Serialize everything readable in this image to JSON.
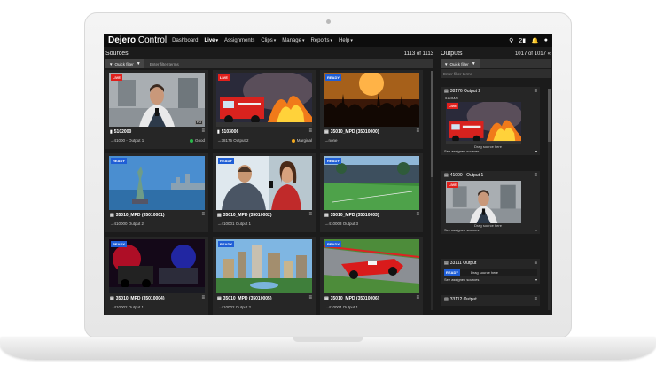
{
  "app": {
    "brand_bold": "Dejero",
    "brand_light": " Control",
    "nav": [
      {
        "label": "Dashboard",
        "dropdown": false,
        "active": false
      },
      {
        "label": "Live",
        "dropdown": true,
        "active": true
      },
      {
        "label": "Assignments",
        "dropdown": false,
        "active": false
      },
      {
        "label": "Clips",
        "dropdown": true,
        "active": false
      },
      {
        "label": "Manage",
        "dropdown": true,
        "active": false
      },
      {
        "label": "Reports",
        "dropdown": true,
        "active": false
      },
      {
        "label": "Help",
        "dropdown": true,
        "active": false
      }
    ],
    "notification_count": "2"
  },
  "sources": {
    "title": "Sources",
    "count": "1113 of 1113",
    "filter_button": "Quick filter",
    "filter_placeholder": "Enter filter terms",
    "cards": [
      {
        "name": "5102000",
        "dest": "→41000 - Output 1",
        "status": "Good",
        "status_color": "#2ab94a",
        "badge": "LIVE",
        "hd": "HD",
        "scene": "reporter"
      },
      {
        "name": "5103006",
        "dest": "→38176 Output 2",
        "status": "Marginal",
        "status_color": "#f2a81d",
        "badge": "LIVE",
        "hd": "",
        "scene": "firetruck"
      },
      {
        "name": "35010_MPD (35010000)",
        "dest": "→none",
        "status": "",
        "status_color": "",
        "badge": "READY",
        "hd": "",
        "scene": "concert"
      },
      {
        "name": "35010_MPD (35010001)",
        "dest": "→410000 Output 2",
        "status": "",
        "status_color": "",
        "badge": "READY",
        "hd": "",
        "scene": "liberty"
      },
      {
        "name": "35010_MPD (35010002)",
        "dest": "→410001 Output 1",
        "status": "",
        "status_color": "",
        "badge": "READY",
        "hd": "",
        "scene": "interview"
      },
      {
        "name": "35010_MPD (35010003)",
        "dest": "→410003 Output 3",
        "status": "",
        "status_color": "",
        "badge": "READY",
        "hd": "",
        "scene": "stadium"
      },
      {
        "name": "35010_MPD (35010004)",
        "dest": "→410002 Output 1",
        "status": "",
        "status_color": "",
        "badge": "READY",
        "hd": "",
        "scene": "police"
      },
      {
        "name": "35010_MPD (35010005)",
        "dest": "→410002 Output 2",
        "status": "",
        "status_color": "",
        "badge": "READY",
        "hd": "",
        "scene": "city"
      },
      {
        "name": "35010_MPD (35010006)",
        "dest": "→410004 Output 1",
        "status": "",
        "status_color": "",
        "badge": "READY",
        "hd": "",
        "scene": "racecar"
      }
    ]
  },
  "outputs": {
    "title": "Outputs",
    "count": "1017 of 1017",
    "filter_button": "Quick filter",
    "filter_placeholder": "Enter filter terms",
    "cards": [
      {
        "name": "38176 Output 2",
        "source_id": "5103006",
        "badge": "LIVE",
        "drag": "Drag source here",
        "assigned": "See assigned sources",
        "scene": "firetruck",
        "ready_text": ""
      },
      {
        "name": "41000 - Output 1",
        "source_id": "",
        "badge": "LIVE",
        "drag": "Drag source here",
        "assigned": "See assigned sources",
        "scene": "reporter",
        "ready_text": ""
      },
      {
        "name": "33111 Output",
        "source_id": "",
        "badge": "READY",
        "drag": "",
        "assigned": "See assigned sources",
        "scene": "",
        "ready_text": "Drag source here"
      },
      {
        "name": "33112 Output",
        "source_id": "",
        "badge": "",
        "drag": "",
        "assigned": "",
        "scene": "",
        "ready_text": ""
      }
    ]
  }
}
